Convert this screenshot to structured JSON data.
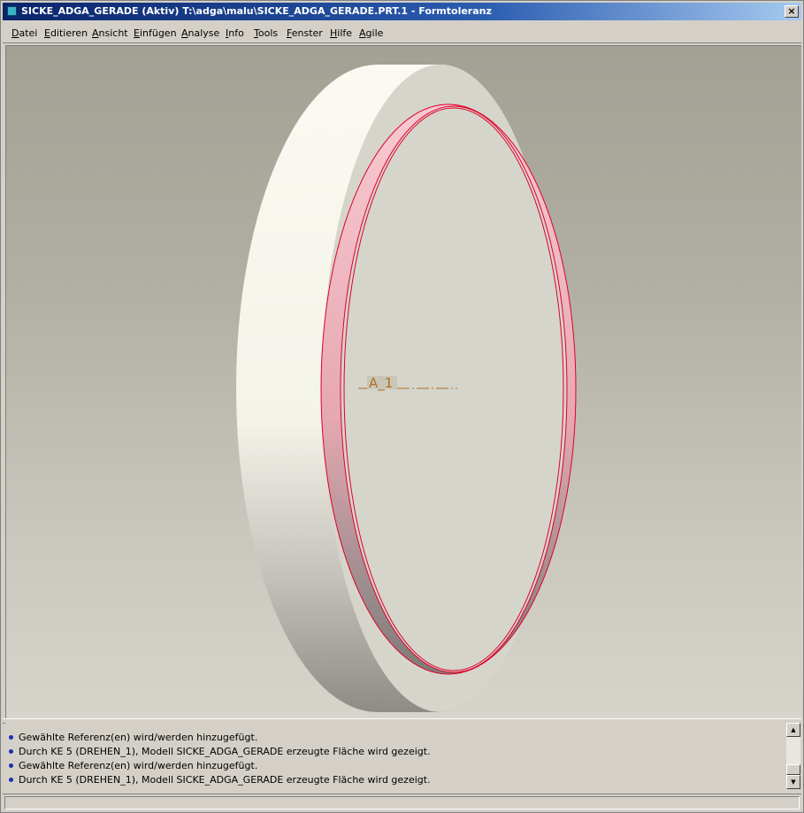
{
  "window": {
    "title": "SICKE_ADGA_GERADE (Aktiv) T:\\adga\\malu\\SICKE_ADGA_GERADE.PRT.1 - Formtoleranz",
    "close_glyph": "×"
  },
  "menu": {
    "items": [
      {
        "label": "Datei"
      },
      {
        "label": "Editieren"
      },
      {
        "label": "Ansicht"
      },
      {
        "label": "Einfügen"
      },
      {
        "label": "Analyse"
      },
      {
        "label": "Info"
      },
      {
        "label": "Tools"
      },
      {
        "label": "Fenster"
      },
      {
        "label": "Hilfe"
      },
      {
        "label": "Agile"
      }
    ]
  },
  "viewport": {
    "axis_label": "A_1",
    "colors": {
      "background_top": "#a3a094",
      "background_bottom": "#d6d4cb",
      "highlight": "#e0002a",
      "highlight_fill": "#f5b3c0",
      "axis": "#b07020"
    }
  },
  "messages": [
    {
      "text": "Gewählte Referenz(en) wird/werden hinzugefügt."
    },
    {
      "text": "Durch KE 5 (DREHEN_1), Modell SICKE_ADGA_GERADE erzeugte Fläche wird gezeigt."
    },
    {
      "text": "Gewählte Referenz(en) wird/werden hinzugefügt."
    },
    {
      "text": "Durch KE 5 (DREHEN_1), Modell SICKE_ADGA_GERADE erzeugte Fläche wird gezeigt."
    }
  ],
  "icons": {
    "app": "app-icon",
    "close": "close-icon",
    "scroll_up": "scroll-up-icon",
    "scroll_down": "scroll-down-icon",
    "message_bullet": "bullet-icon"
  }
}
